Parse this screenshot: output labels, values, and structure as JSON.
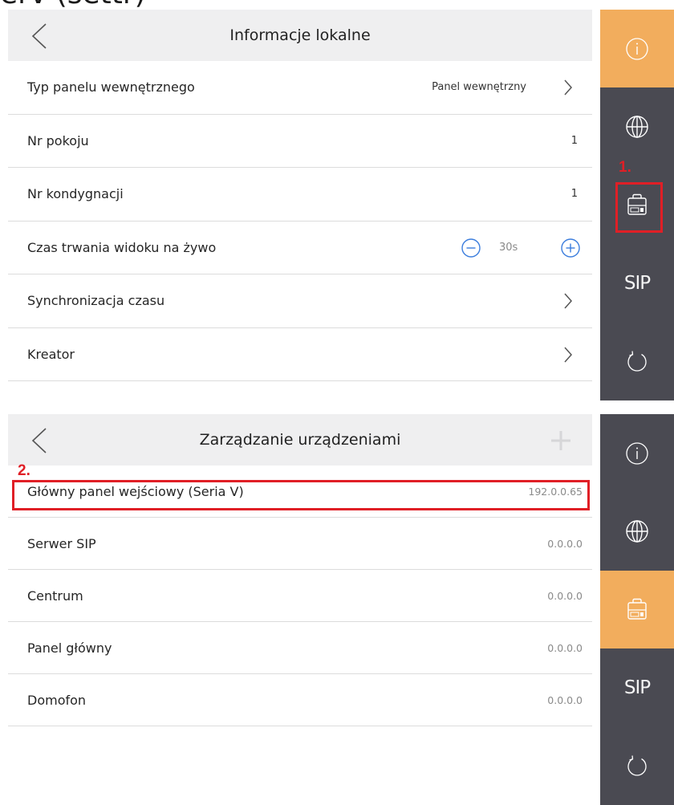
{
  "top_fragment": "erv (settr)",
  "screen1": {
    "title": "Informacje lokalne",
    "rows": [
      {
        "label": "Typ panelu wewnętrznego",
        "value": "Panel wewnętrzny"
      },
      {
        "label": "Nr pokoju",
        "value": "1"
      },
      {
        "label": "Nr kondygnacji",
        "value": "1"
      },
      {
        "label": "Czas trwania widoku na żywo",
        "value": "30s"
      },
      {
        "label": "Synchronizacja czasu"
      },
      {
        "label": "Kreator"
      }
    ],
    "sidebar": [
      {
        "icon": "info-icon",
        "active": true
      },
      {
        "icon": "globe-icon",
        "active": false
      },
      {
        "icon": "device-icon",
        "active": false
      },
      {
        "label": "SIP",
        "active": false
      },
      {
        "icon": "refresh-icon",
        "active": false
      }
    ],
    "annotation": "1."
  },
  "screen2": {
    "title": "Zarządzanie urządzeniami",
    "rows": [
      {
        "label": "Główny panel wejściowy (Seria V)",
        "value": "192.0.0.65"
      },
      {
        "label": "Serwer SIP",
        "value": "0.0.0.0"
      },
      {
        "label": "Centrum",
        "value": "0.0.0.0"
      },
      {
        "label": "Panel główny",
        "value": "0.0.0.0"
      },
      {
        "label": "Domofon",
        "value": "0.0.0.0"
      }
    ],
    "sidebar": [
      {
        "icon": "info-icon",
        "active": false
      },
      {
        "icon": "globe-icon",
        "active": false
      },
      {
        "icon": "device-icon",
        "active": true
      },
      {
        "label": "SIP",
        "active": false
      },
      {
        "icon": "refresh-icon",
        "active": false
      }
    ],
    "annotation": "2."
  },
  "colors": {
    "accent": "#f2ad5d",
    "sidebar": "#4a4a52",
    "header": "#efeff0",
    "annotation_red": "#e01f26",
    "link_blue": "#3b7ddd"
  }
}
